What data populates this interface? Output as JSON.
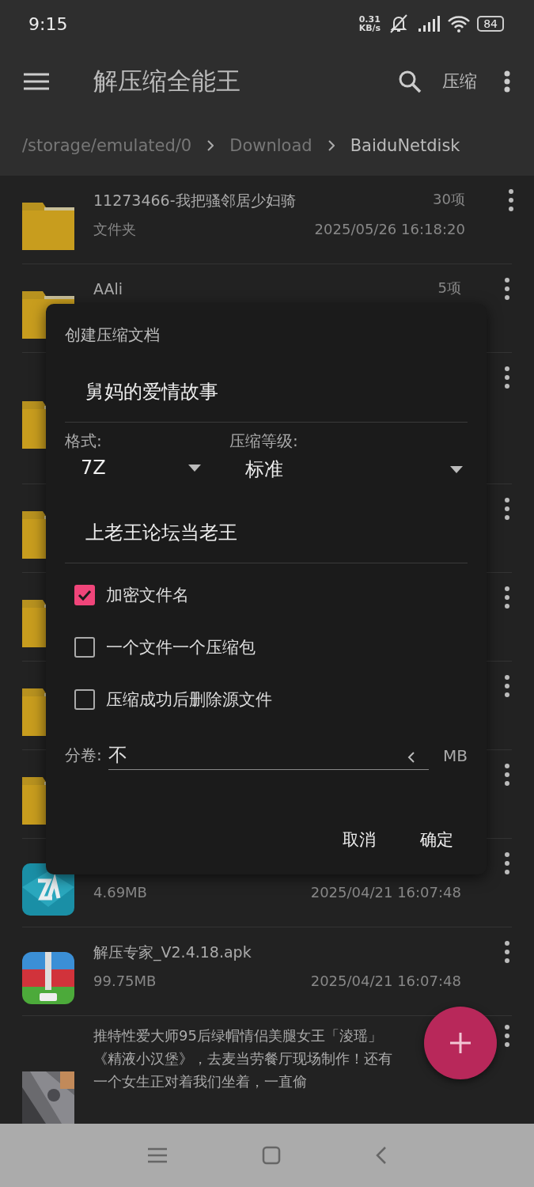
{
  "status_bar": {
    "time": "9:15",
    "net_speed_value": "0.31",
    "net_speed_unit": "KB/s",
    "battery": "84"
  },
  "toolbar": {
    "title": "解压缩全能王",
    "compress_action": "压缩"
  },
  "breadcrumb": [
    {
      "label": "/storage/emulated/0",
      "selected": false
    },
    {
      "label": "Download",
      "selected": false
    },
    {
      "label": "BaiduNetdisk",
      "selected": true
    }
  ],
  "files": [
    {
      "kind": "folder",
      "name": "11273466-我把骚邻居少妇骑",
      "type": "文件夹",
      "count": "30项",
      "date": "2025/05/26 16:18:20"
    },
    {
      "kind": "folder",
      "name": "AAli",
      "count": "5项"
    },
    {
      "kind": "folder"
    },
    {
      "kind": "folder"
    },
    {
      "kind": "folder"
    },
    {
      "kind": "folder"
    },
    {
      "kind": "folder"
    },
    {
      "kind": "zarchiver",
      "size": "4.69MB",
      "date": "2025/04/21 16:07:48"
    },
    {
      "kind": "zip-app",
      "name": "解压专家_V2.4.18.apk",
      "size": "99.75MB",
      "date": "2025/04/21 16:07:48"
    },
    {
      "kind": "video",
      "name": "推特性爱大师95后绿帽情侣美腿女王「淩瑶」《精液小汉堡》，去麦当劳餐厅现场制作！还有一个女生正对着我们坐着，一直偷"
    }
  ],
  "dialog": {
    "title": "创建压缩文档",
    "archive_name": "舅妈的爱情故事",
    "format_label": "格式:",
    "format": "7Z",
    "level_label": "压缩等级:",
    "level_value": "标准",
    "password": "上老王论坛当老王",
    "options": [
      {
        "label": "加密文件名",
        "checked": true
      },
      {
        "label": "一个文件一个压缩包",
        "checked": false
      },
      {
        "label": "压缩成功后删除源文件",
        "checked": false
      }
    ],
    "volume_label": "分卷:",
    "volume_value": "不",
    "volume_unit": "MB",
    "buttons": [
      {
        "label": "取消"
      },
      {
        "label": "确定"
      }
    ]
  }
}
